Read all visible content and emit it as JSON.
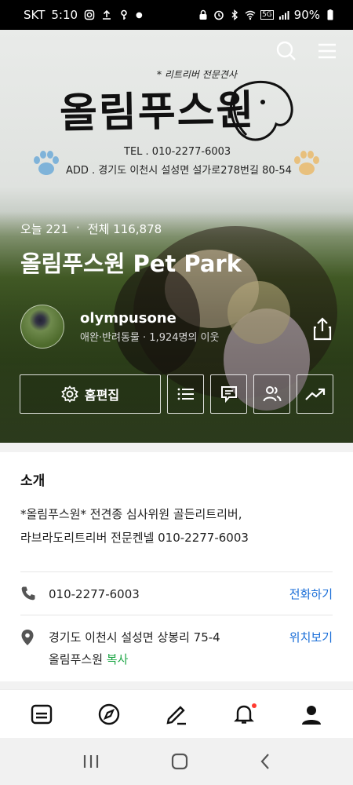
{
  "status_bar": {
    "carrier": "SKT",
    "time": "5:10",
    "battery": "90%",
    "network": "5G"
  },
  "hero": {
    "logo_subtitle": "* 리트리버 전문견사",
    "logo_title": "올림푸스원",
    "tel": "TEL . 010-2277-6003",
    "address": "ADD . 경기도 이천시 설성면 설가로278번길 80-54",
    "visits_today": "오늘 221",
    "visits_sep": "·",
    "visits_total": "전체 116,878",
    "blog_title": "올림푸스원 Pet Park"
  },
  "profile": {
    "name": "olympusone",
    "meta": "애완·반려동물 · 1,924명의 이웃"
  },
  "actions": {
    "edit_home": "홈편집"
  },
  "intro": {
    "title": "소개",
    "line1": "*올림푸스원* 전견종 심사위원 골든리트리버,",
    "line2": "라브라도리트리버 전문켄넬 010-2277-6003"
  },
  "contact": {
    "phone": "010-2277-6003",
    "call_label": "전화하기",
    "address_line1": "경기도 이천시 설성면 상봉리 75-4",
    "address_line2": "올림푸스원",
    "copy_label": "복사",
    "map_label": "위치보기"
  },
  "icons": {
    "search": "search-icon",
    "menu": "menu-icon",
    "share": "share-icon",
    "settings": "gear-icon",
    "list": "list-icon",
    "comment": "comment-icon",
    "neighbors": "people-icon",
    "stats": "trend-icon",
    "phone": "phone-icon",
    "pin": "location-pin-icon",
    "feed": "feed-icon",
    "explore": "compass-icon",
    "write": "pencil-icon",
    "notify": "bell-icon",
    "my": "person-icon"
  },
  "colors": {
    "accent": "#1a6ed8",
    "copy": "#22a84a",
    "badge": "#ff3b30"
  }
}
